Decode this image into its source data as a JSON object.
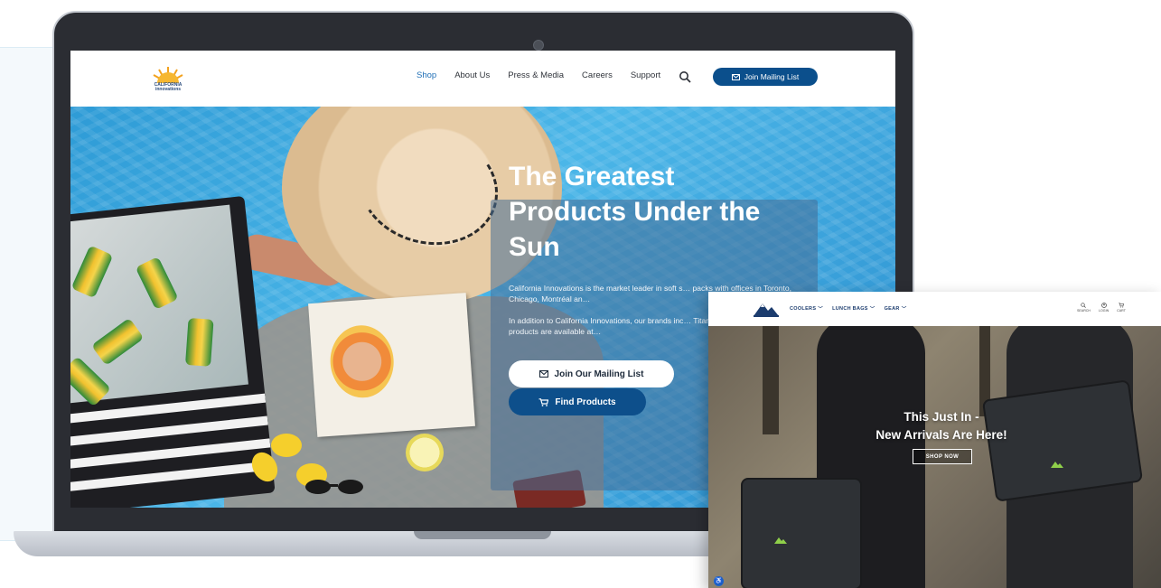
{
  "laptop_site": {
    "logo": {
      "text": "CALIFORNIA\ninnovations",
      "icon": "sun-logo-icon"
    },
    "nav": {
      "items": [
        {
          "label": "Shop",
          "active": true
        },
        {
          "label": "About Us",
          "active": false
        },
        {
          "label": "Press & Media",
          "active": false
        },
        {
          "label": "Careers",
          "active": false
        },
        {
          "label": "Support",
          "active": false
        }
      ],
      "search_icon": "search-icon"
    },
    "mailing_button": {
      "label": "Join Mailing List",
      "icon": "envelope-icon"
    },
    "hero": {
      "title": "The Greatest Products Under the Sun",
      "paragraph1": "California Innovations is the market leader in soft s… packs with offices in Toronto, Chicago, Montréal an…",
      "paragraph2": "In addition to California Innovations, our brands inc… Titan Deep Freeze®. Our products are available at…",
      "primary_button": {
        "label": "Join Our Mailing List",
        "icon": "envelope-icon"
      },
      "secondary_button": {
        "label": "Find Products",
        "icon": "cart-icon"
      }
    }
  },
  "second_window": {
    "nav": [
      {
        "label": "COOLERS"
      },
      {
        "label": "LUNCH BAGS"
      },
      {
        "label": "GEAR"
      }
    ],
    "utility": [
      {
        "label": "SEARCH",
        "icon": "search-icon"
      },
      {
        "label": "LOGIN",
        "icon": "user-icon"
      },
      {
        "label": "CART",
        "icon": "cart-icon"
      }
    ],
    "hero": {
      "title_line1": "This Just In -",
      "title_line2": "New Arrivals Are Here!",
      "button": "SHOP NOW"
    }
  },
  "colors": {
    "brand_blue": "#0b4f8c",
    "nav_active": "#1f6fb6",
    "pool_blue": "#3aa8e0",
    "hero_text": "#ffffff"
  }
}
